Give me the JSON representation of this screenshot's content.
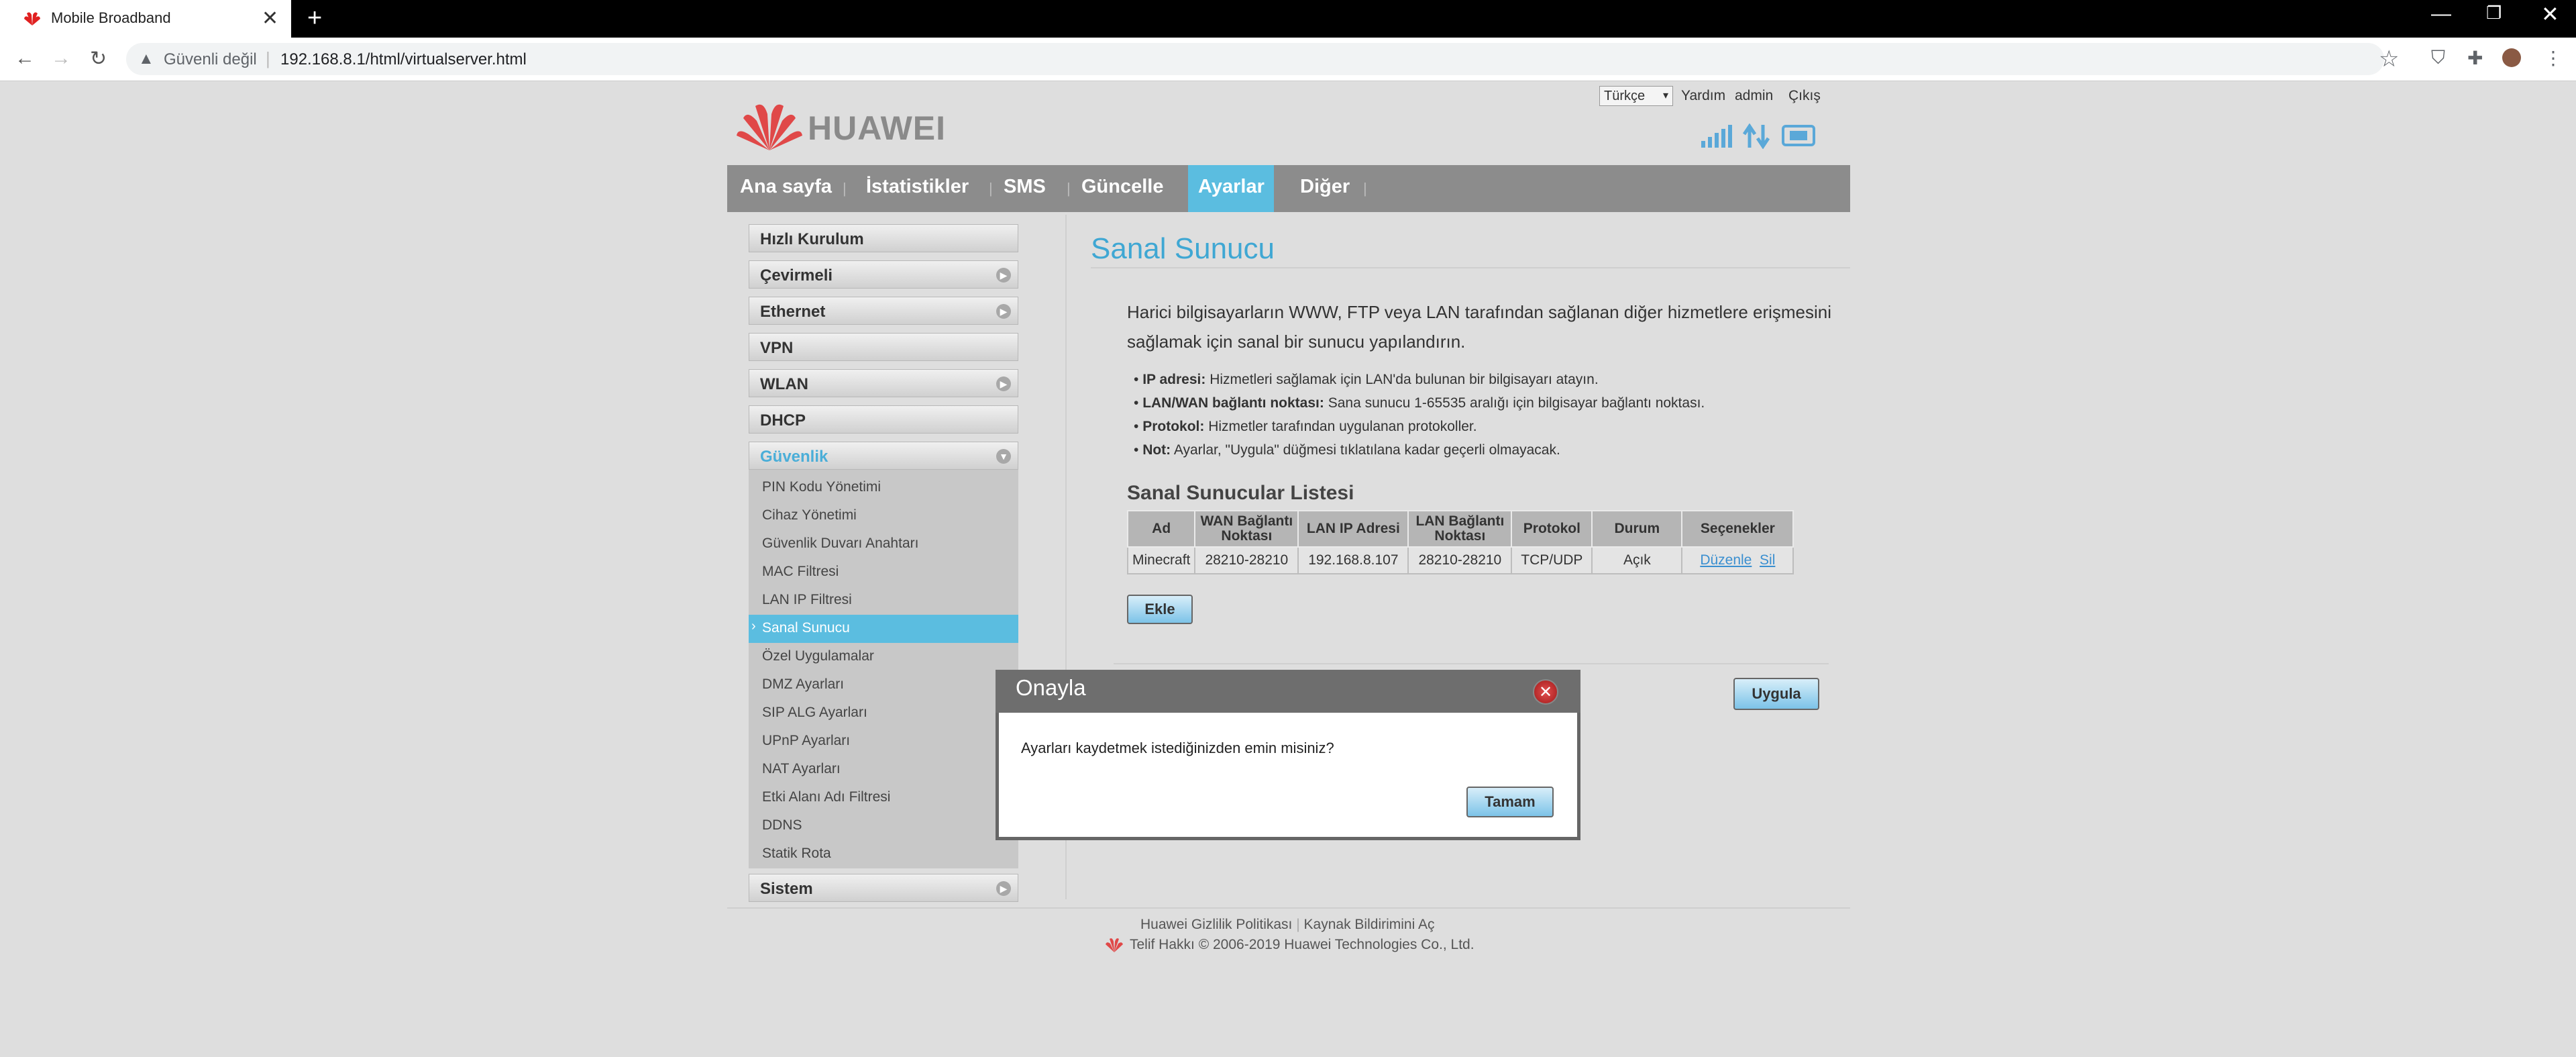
{
  "browser": {
    "tab_title": "Mobile Broadband",
    "tab_close": "✕",
    "new_tab": "+",
    "security": "Güvenli değil",
    "url": "192.168.8.1/html/virtualserver.html",
    "window_controls": {
      "minimize": "—",
      "restore": "❐",
      "close": "✕"
    }
  },
  "header": {
    "logo_text": "HUAWEI",
    "language": "Türkçe",
    "help": "Yardım",
    "user": "admin",
    "logout": "Çıkış"
  },
  "nav": {
    "items": [
      "Ana sayfa",
      "İstatistikler",
      "SMS",
      "Güncelle",
      "Ayarlar",
      "Diğer"
    ],
    "active": "Ayarlar"
  },
  "sidebar": {
    "groups": [
      {
        "label": "Hızlı Kurulum",
        "expandable": false
      },
      {
        "label": "Çevirmeli",
        "expandable": true
      },
      {
        "label": "Ethernet",
        "expandable": true
      },
      {
        "label": "VPN",
        "expandable": false
      },
      {
        "label": "WLAN",
        "expandable": true
      },
      {
        "label": "DHCP",
        "expandable": false
      },
      {
        "label": "Güvenlik",
        "expandable": true
      },
      {
        "label": "Sistem",
        "expandable": true
      }
    ],
    "security_items": [
      "PIN Kodu Yönetimi",
      "Cihaz Yönetimi",
      "Güvenlik Duvarı Anahtarı",
      "MAC Filtresi",
      "LAN IP Filtresi",
      "Sanal Sunucu",
      "Özel Uygulamalar",
      "DMZ Ayarları",
      "SIP ALG Ayarları",
      "UPnP Ayarları",
      "NAT Ayarları",
      "Etki Alanı Adı Filtresi",
      "DDNS",
      "Statik Rota"
    ],
    "active_item": "Sanal Sunucu"
  },
  "content": {
    "title": "Sanal Sunucu",
    "desc_line1": "Harici bilgisayarların WWW, FTP veya LAN tarafından sağlanan diğer hizmetlere erişmesini",
    "desc_line2": "sağlamak için sanal bir sunucu yapılandırın.",
    "bullets": [
      {
        "term": "IP adresi:",
        "text": "Hizmetleri sağlamak için LAN'da bulunan bir bilgisayarı atayın."
      },
      {
        "term": "LAN/WAN bağlantı noktası:",
        "text": "Sana sunucu 1-65535 aralığı için bilgisayar bağlantı noktası."
      },
      {
        "term": "Protokol:",
        "text": "Hizmetler tarafından uygulanan protokoller."
      },
      {
        "term": "Not:",
        "text": "Ayarlar, \"Uygula\" düğmesi tıklatılana kadar geçerli olmayacak."
      }
    ],
    "list_title": "Sanal Sunucular Listesi",
    "table": {
      "headers": [
        "Ad",
        "WAN Bağlantı Noktası",
        "LAN IP Adresi",
        "LAN Bağlantı Noktası",
        "Protokol",
        "Durum",
        "Seçenekler"
      ],
      "rows": [
        {
          "name": "Minecraft",
          "wan": "28210-28210",
          "ip": "192.168.8.107",
          "lan": "28210-28210",
          "protocol": "TCP/UDP",
          "status": "Açık",
          "edit": "Düzenle",
          "delete": "Sil"
        }
      ]
    },
    "add_button": "Ekle",
    "apply_button": "Uygula"
  },
  "footer": {
    "privacy": "Huawei Gizlilik Politikası",
    "source": "Kaynak Bildirimini Aç",
    "copyright": "Telif Hakkı © 2006-2019 Huawei Technologies Co., Ltd."
  },
  "modal": {
    "title": "Onayla",
    "message": "Ayarları kaydetmek istediğinizden emin misiniz?",
    "ok": "Tamam"
  }
}
